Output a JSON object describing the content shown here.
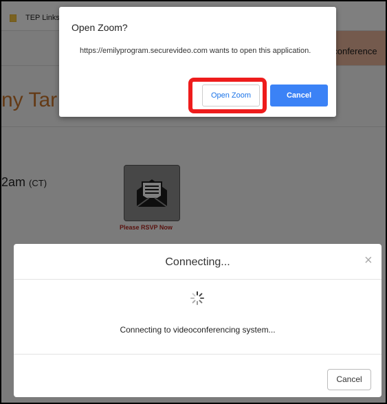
{
  "bookmarks": {
    "folder_label": "TEP Links"
  },
  "page": {
    "banner_text": "oconference",
    "name_title": "ny Tar",
    "time_main": "2am ",
    "time_zone": "(CT)",
    "rsvp_label": "Please RSVP Now"
  },
  "prompt": {
    "title": "Open Zoom?",
    "message": "https://emilyprogram.securevideo.com wants to open this application.",
    "open_label": "Open Zoom",
    "cancel_label": "Cancel"
  },
  "connecting": {
    "title": "Connecting...",
    "close_glyph": "×",
    "message": "Connecting to videoconferencing system...",
    "cancel_label": "Cancel"
  },
  "colors": {
    "highlight": "#ee1c1c",
    "primary_button": "#3b82f6",
    "title_orange": "#c8742a",
    "banner": "#e8b59a",
    "rsvp_red": "#b3261e"
  },
  "icons": [
    "folder-icon",
    "envelope-open-icon",
    "spinner-icon",
    "close-icon"
  ]
}
